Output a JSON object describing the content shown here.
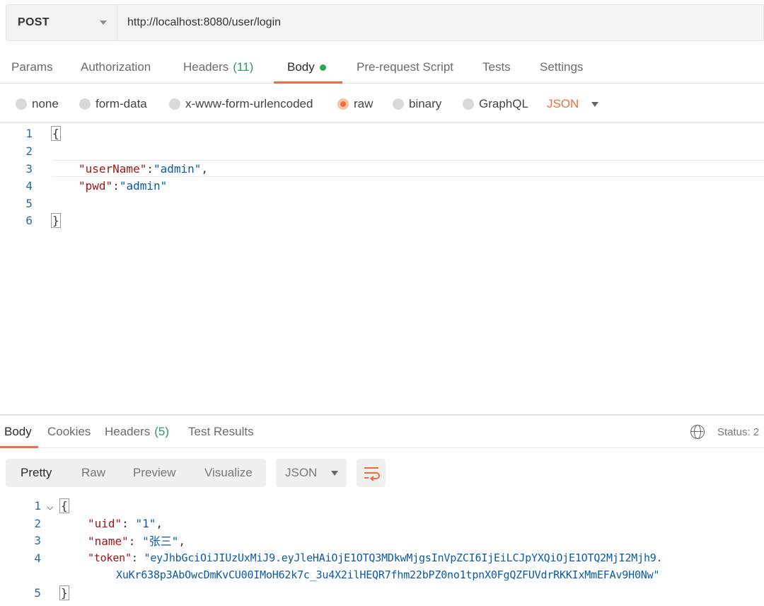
{
  "request": {
    "method": "POST",
    "url": "http://localhost:8080/user/login"
  },
  "request_tabs": [
    {
      "label": "Params"
    },
    {
      "label": "Authorization"
    },
    {
      "label": "Headers",
      "count": "(11)"
    },
    {
      "label": "Body"
    },
    {
      "label": "Pre-request Script"
    },
    {
      "label": "Tests"
    },
    {
      "label": "Settings"
    }
  ],
  "body_types": {
    "none": "none",
    "form_data": "form-data",
    "urlencoded": "x-www-form-urlencoded",
    "raw": "raw",
    "binary": "binary",
    "graphql": "GraphQL",
    "format": "JSON"
  },
  "request_body": {
    "line_numbers": [
      "1",
      "2",
      "3",
      "4",
      "5",
      "6"
    ],
    "open_brace": "{",
    "close_brace": "}",
    "username_key": "\"userName\"",
    "username_value": "\"admin\"",
    "pwd_key": "\"pwd\"",
    "pwd_value": "\"admin\""
  },
  "response_tabs": {
    "body": "Body",
    "cookies": "Cookies",
    "headers": "Headers",
    "headers_count": "(5)",
    "test_results": "Test Results",
    "status_label": "Status: 2"
  },
  "response_view": {
    "pretty": "Pretty",
    "raw": "Raw",
    "preview": "Preview",
    "visualize": "Visualize",
    "format": "JSON"
  },
  "response_body": {
    "line_numbers": [
      "1",
      "2",
      "3",
      "4",
      "5"
    ],
    "open_brace": "{",
    "close_brace": "}",
    "uid_key": "\"uid\"",
    "uid_value": "\"1\"",
    "name_key": "\"name\"",
    "name_value": "\"张三\"",
    "token_key": "\"token\"",
    "token_value_line1": "\"eyJhbGciOiJIUzUxMiJ9.eyJleHAiOjE1OTQ3MDkwMjgsInVpZCI6IjEiLCJpYXQiOjE1OTQ2MjI2Mjh9.",
    "token_value_line2": "XuKr638p3AbOwcDmKvCU00IMoH62k7c_3u4X2ilHEQR7fhm22bPZ0no1tpnX0FgQZFUVdrRKKIxMmEFAv9H0Nw\""
  },
  "colors": {
    "accent": "#f26b3a",
    "key": "#a31515",
    "string": "#0b5aa8",
    "count": "#2e9b5b"
  }
}
